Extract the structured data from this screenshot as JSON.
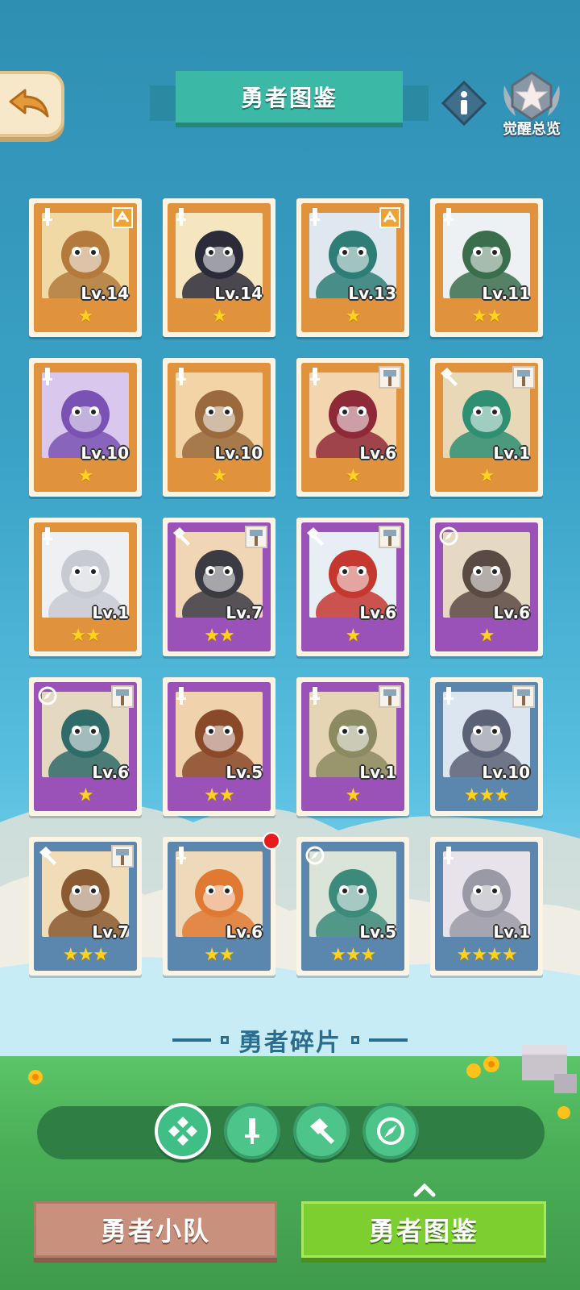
{
  "header": {
    "title": "勇者图鉴",
    "back_icon": "back-arrow-icon",
    "info_icon": "info-icon",
    "awaken_label": "觉醒总览"
  },
  "heroes": [
    {
      "level": "Lv.14",
      "stars": 1,
      "frame": "orange",
      "class_icon": "sword-icon",
      "badge": "awaken-rune-icon",
      "art": "lion-warrior"
    },
    {
      "level": "Lv.14",
      "stars": 1,
      "frame": "orange",
      "class_icon": "sword-icon",
      "badge": "",
      "art": "penguin-girl"
    },
    {
      "level": "Lv.13",
      "stars": 1,
      "frame": "orange",
      "class_icon": "sword-icon",
      "badge": "awaken-rune-icon",
      "art": "polar-bear"
    },
    {
      "level": "Lv.11",
      "stars": 2,
      "frame": "orange",
      "class_icon": "sword-icon",
      "badge": "",
      "art": "seal-gentleman"
    },
    {
      "level": "Lv.10",
      "stars": 1,
      "frame": "orange",
      "class_icon": "sword-icon",
      "badge": "",
      "art": "purple-elephant"
    },
    {
      "level": "Lv.10",
      "stars": 1,
      "frame": "orange",
      "class_icon": "sword-icon",
      "badge": "",
      "art": "squirrel-ranger"
    },
    {
      "level": "Lv.6",
      "stars": 1,
      "frame": "orange",
      "class_icon": "sword-icon",
      "badge": "hammer-badge-icon",
      "art": "red-dragon"
    },
    {
      "level": "Lv.1",
      "stars": 1,
      "frame": "orange",
      "class_icon": "hammer-icon",
      "badge": "hammer-badge-icon",
      "art": "crocodile-gentleman"
    },
    {
      "level": "Lv.1",
      "stars": 2,
      "frame": "orange",
      "class_icon": "sword-icon",
      "badge": "",
      "art": "white-wolf"
    },
    {
      "level": "Lv.7",
      "stars": 2,
      "frame": "purple",
      "class_icon": "hammer-icon",
      "badge": "hammer-badge-icon",
      "art": "black-cat"
    },
    {
      "level": "Lv.6",
      "stars": 1,
      "frame": "purple",
      "class_icon": "hammer-icon",
      "badge": "hammer-badge-icon",
      "art": "white-dog"
    },
    {
      "level": "Lv.6",
      "stars": 1,
      "frame": "purple",
      "class_icon": "compass-icon",
      "badge": "",
      "art": "masked-goat"
    },
    {
      "level": "Lv.6",
      "stars": 1,
      "frame": "purple",
      "class_icon": "compass-icon",
      "badge": "hammer-badge-icon",
      "art": "duck-trio"
    },
    {
      "level": "Lv.5",
      "stars": 2,
      "frame": "purple",
      "class_icon": "sword-icon",
      "badge": "",
      "art": "brown-lizard"
    },
    {
      "level": "Lv.1",
      "stars": 1,
      "frame": "purple",
      "class_icon": "sword-icon",
      "badge": "hammer-badge-icon",
      "art": "antler-deer"
    },
    {
      "level": "Lv.10",
      "stars": 3,
      "frame": "blue",
      "class_icon": "sword-icon",
      "badge": "hammer-badge-icon",
      "art": "gray-rabbit"
    },
    {
      "level": "Lv.7",
      "stars": 3,
      "frame": "blue",
      "class_icon": "hammer-icon",
      "badge": "hammer-badge-icon",
      "art": "hooded-girl"
    },
    {
      "level": "Lv.6",
      "stars": 2,
      "frame": "blue",
      "class_icon": "sword-icon",
      "badge": "",
      "art": "fox-officer",
      "notify": true
    },
    {
      "level": "Lv.5",
      "stars": 3,
      "frame": "blue",
      "class_icon": "compass-icon",
      "badge": "",
      "art": "frog-wizard"
    },
    {
      "level": "Lv.1",
      "stars": 4,
      "frame": "blue",
      "class_icon": "sword-icon",
      "badge": "",
      "art": "raccoon-girl"
    }
  ],
  "fragments": {
    "title": "勇者碎片"
  },
  "filters": [
    {
      "icon": "all-classes-icon",
      "active": true
    },
    {
      "icon": "sword-icon",
      "active": false
    },
    {
      "icon": "hammer-icon",
      "active": false
    },
    {
      "icon": "compass-icon",
      "active": false
    }
  ],
  "bottom_tabs": {
    "team": "勇者小队",
    "book": "勇者图鉴"
  },
  "colors": {
    "orange_frame": "#e0933c",
    "purple_frame": "#9a52b8",
    "blue_frame": "#5b86ad",
    "star": "#ffd21e",
    "title_bg": "#3bb8a6",
    "active_tab": "#7ccf2e",
    "inactive_tab": "#c9907e"
  }
}
